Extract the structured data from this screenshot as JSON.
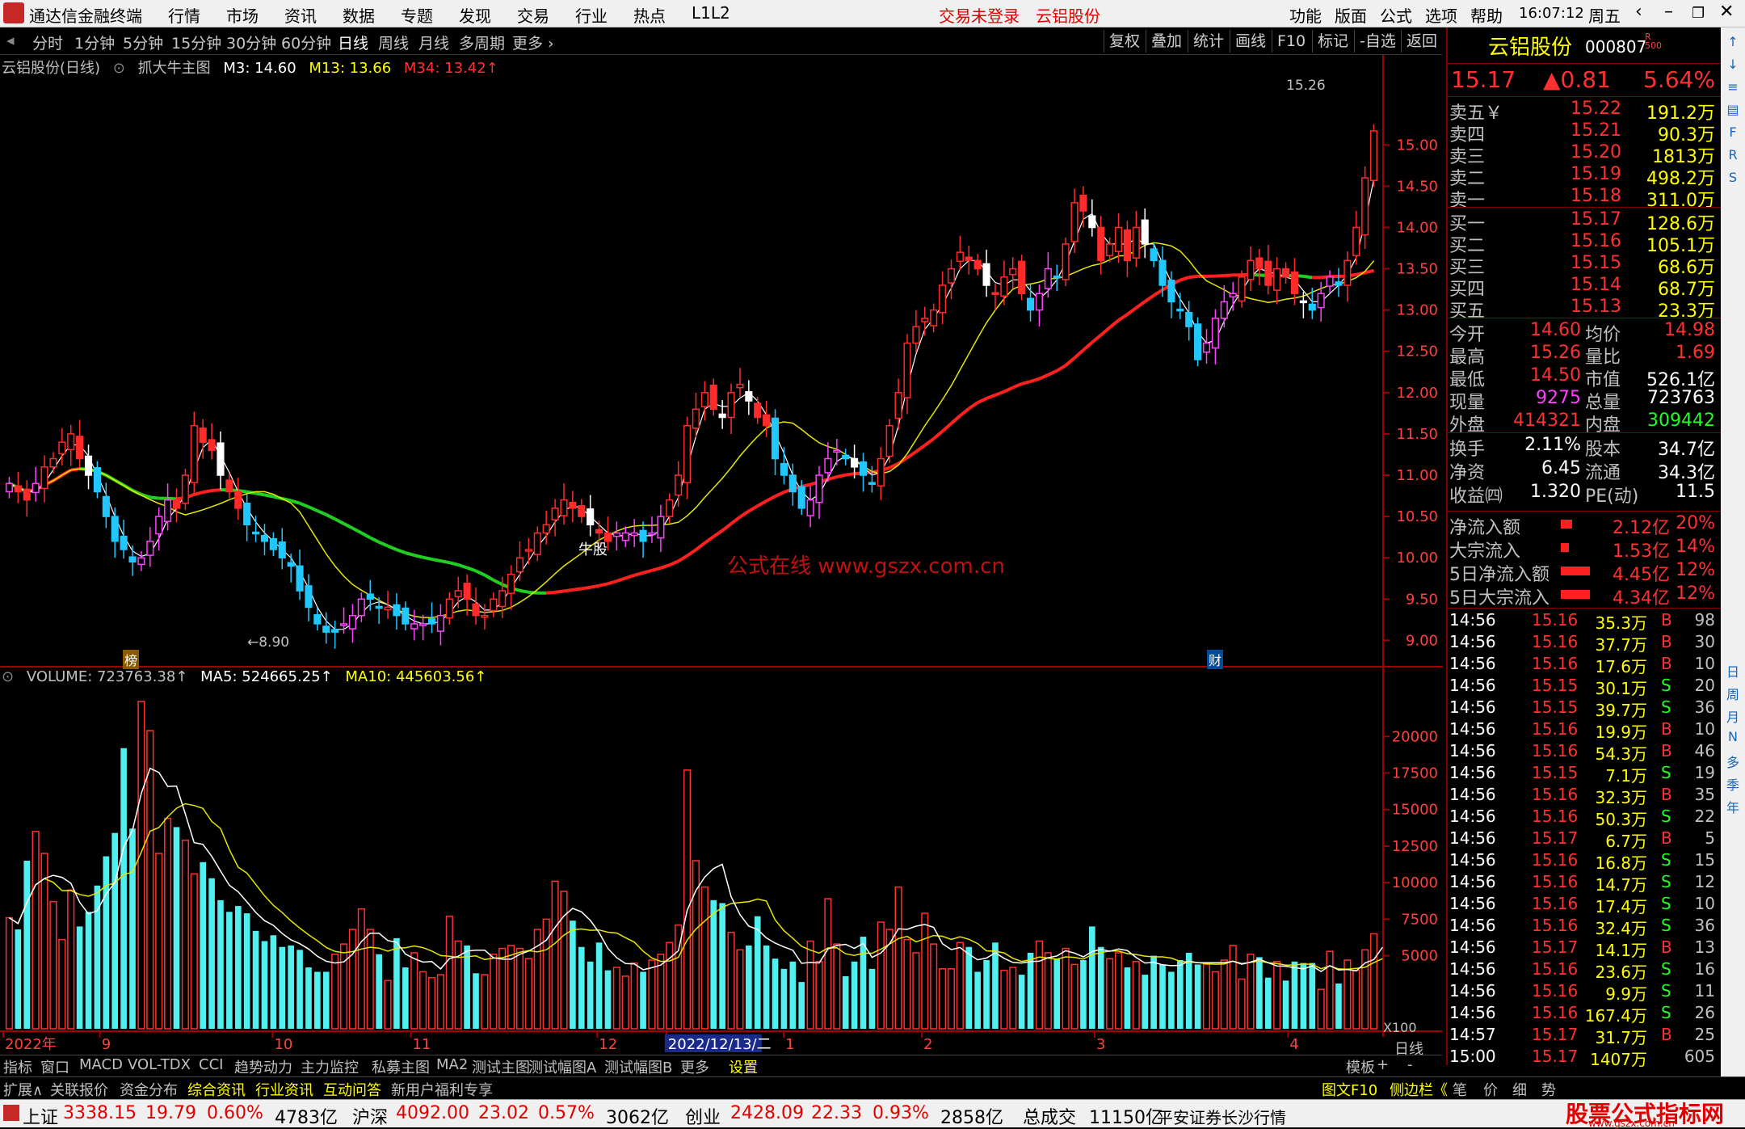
{
  "menubar": {
    "app_title": "通达信金融终端",
    "menus": [
      "行情",
      "市场",
      "资讯",
      "数据",
      "专题",
      "发现",
      "交易",
      "行业",
      "热点",
      "L1L2"
    ],
    "login_status": "交易未登录",
    "stock_name": "云铝股份",
    "right_menus": [
      "功能",
      "版面",
      "公式",
      "选项",
      "帮助"
    ],
    "time": "16:07:12",
    "weekday": "周五"
  },
  "periodbar": {
    "periods": [
      "分时",
      "1分钟",
      "5分钟",
      "15分钟",
      "30分钟",
      "60分钟",
      "日线",
      "周线",
      "月线",
      "多周期",
      "更多 ›"
    ],
    "active": "日线",
    "tools": [
      "复权",
      "叠加",
      "统计",
      "画线",
      "F10",
      "标记",
      "-自选",
      "返回"
    ]
  },
  "chart_legend": {
    "title": "云铝股份(日线)",
    "indicator": "抓大牛主图",
    "m3": "M3: 14.60",
    "m13": "M13: 13.66",
    "m34": "M34: 13.42↑",
    "high_label": "15.26",
    "low_label": "←8.90",
    "bull_label": "牛股",
    "watermark": "公式在线  www.gszx.com.cn",
    "marker_bang": "榜",
    "marker_cai": "财"
  },
  "volume_legend": {
    "volume": "VOLUME: 723763.38↑",
    "ma5": "MA5: 524665.25↑",
    "ma10": "MA10: 445603.56↑",
    "unit": "X100",
    "period_label": "日线"
  },
  "price_axis": [
    "15.00",
    "14.50",
    "14.00",
    "13.50",
    "13.00",
    "12.50",
    "12.00",
    "11.50",
    "11.00",
    "10.50",
    "10.00",
    "9.50",
    "9.00"
  ],
  "volume_axis": [
    "20000",
    "17500",
    "15000",
    "12500",
    "10000",
    "7500",
    "5000"
  ],
  "date_axis": [
    "2022年",
    "9",
    "10",
    "11",
    "12",
    "2022/12/13/二",
    "1",
    "2",
    "3",
    "4"
  ],
  "quote": {
    "name": "云铝股份",
    "code": "000807",
    "flags": "R 500",
    "price": "15.17",
    "change": "▲0.81",
    "pct": "5.64%",
    "asks": [
      {
        "label": "卖五￥",
        "price": "15.22",
        "vol": "191.2万"
      },
      {
        "label": "卖四",
        "price": "15.21",
        "vol": "90.3万"
      },
      {
        "label": "卖三",
        "price": "15.20",
        "vol": "1813万"
      },
      {
        "label": "卖二",
        "price": "15.19",
        "vol": "498.2万"
      },
      {
        "label": "卖一",
        "price": "15.18",
        "vol": "311.0万"
      }
    ],
    "bids": [
      {
        "label": "买一",
        "price": "15.17",
        "vol": "128.6万"
      },
      {
        "label": "买二",
        "price": "15.16",
        "vol": "105.1万"
      },
      {
        "label": "买三",
        "price": "15.15",
        "vol": "68.6万"
      },
      {
        "label": "买四",
        "price": "15.14",
        "vol": "68.7万"
      },
      {
        "label": "买五",
        "price": "15.13",
        "vol": "23.3万"
      }
    ],
    "stats1": [
      {
        "l1": "今开",
        "v1": "14.60",
        "l2": "均价",
        "v2": "14.98"
      },
      {
        "l1": "最高",
        "v1": "15.26",
        "l2": "量比",
        "v2": "1.69"
      },
      {
        "l1": "最低",
        "v1": "14.50",
        "l2": "市值",
        "v2": "526.1亿"
      },
      {
        "l1": "现量",
        "v1": "9275",
        "l2": "总量",
        "v2": "723763"
      },
      {
        "l1": "外盘",
        "v1": "414321",
        "l2": "内盘",
        "v2": "309442"
      }
    ],
    "stats2": [
      {
        "l1": "换手",
        "v1": "2.11%",
        "l2": "股本",
        "v2": "34.7亿"
      },
      {
        "l1": "净资",
        "v1": "6.45",
        "l2": "流通",
        "v2": "34.3亿"
      },
      {
        "l1": "收益㈣",
        "v1": "1.320",
        "l2": "PE(动)",
        "v2": "11.5"
      }
    ],
    "flows": [
      {
        "label": "净流入额",
        "val": "2.12亿",
        "pct": "20%",
        "bar": 0.2
      },
      {
        "label": "大宗流入",
        "val": "1.53亿",
        "pct": "14%",
        "bar": 0.14
      },
      {
        "label": "5日净流入额",
        "val": "4.45亿",
        "pct": "12%",
        "bar": 0.5
      },
      {
        "label": "5日大宗流入",
        "val": "4.34亿",
        "pct": "12%",
        "bar": 0.5
      }
    ]
  },
  "ticks": [
    [
      "14:56",
      "15.16",
      "35.3万",
      "B",
      "98"
    ],
    [
      "14:56",
      "15.16",
      "37.7万",
      "B",
      "30"
    ],
    [
      "14:56",
      "15.16",
      "17.6万",
      "B",
      "10"
    ],
    [
      "14:56",
      "15.15",
      "30.1万",
      "S",
      "20"
    ],
    [
      "14:56",
      "15.15",
      "39.7万",
      "S",
      "36"
    ],
    [
      "14:56",
      "15.16",
      "19.9万",
      "B",
      "10"
    ],
    [
      "14:56",
      "15.16",
      "54.3万",
      "B",
      "46"
    ],
    [
      "14:56",
      "15.15",
      "7.1万",
      "S",
      "19"
    ],
    [
      "14:56",
      "15.16",
      "32.3万",
      "B",
      "35"
    ],
    [
      "14:56",
      "15.16",
      "50.3万",
      "S",
      "22"
    ],
    [
      "14:56",
      "15.17",
      "6.7万",
      "B",
      "5"
    ],
    [
      "14:56",
      "15.16",
      "16.8万",
      "S",
      "15"
    ],
    [
      "14:56",
      "15.16",
      "14.7万",
      "S",
      "12"
    ],
    [
      "14:56",
      "15.16",
      "17.4万",
      "S",
      "10"
    ],
    [
      "14:56",
      "15.16",
      "32.4万",
      "S",
      "36"
    ],
    [
      "14:56",
      "15.17",
      "14.1万",
      "B",
      "13"
    ],
    [
      "14:56",
      "15.16",
      "23.6万",
      "S",
      "16"
    ],
    [
      "14:56",
      "15.16",
      "9.9万",
      "S",
      "11"
    ],
    [
      "14:56",
      "15.16",
      "167.4万",
      "S",
      "26"
    ],
    [
      "14:57",
      "15.17",
      "31.7万",
      "B",
      "25"
    ],
    [
      "15:00",
      "15.17",
      "1407万",
      "",
      "605"
    ]
  ],
  "bottom_tabs": [
    "指标",
    "窗口",
    "MACD",
    "VOL-TDX",
    "CCI",
    "趋势动力",
    "主力监控",
    "私募主图",
    "MA2",
    "测试主图",
    "测试幅图A",
    "测试幅图B",
    "更多",
    "设置"
  ],
  "bottom_right": [
    "模板",
    "+",
    "-"
  ],
  "bottom_tabs2": [
    "扩展∧",
    "关联报价",
    "资金分布",
    "综合资讯",
    "行业资讯",
    "互动问答",
    "新用户福利专享"
  ],
  "bottom_tabs2_right": [
    "图文F10",
    "侧边栏《",
    "笔",
    "价",
    "细",
    "势"
  ],
  "status": {
    "sh_label": "上证",
    "sh_val": "3338.15",
    "sh_chg": "19.79",
    "sh_pct": "0.60%",
    "sh_amt": "4783亿",
    "sz_label": "沪深",
    "sz_val": "4092.00",
    "sz_chg": "23.02",
    "sz_pct": "0.57%",
    "sz_amt": "3062亿",
    "cy_label": "创业",
    "cy_val": "2428.09",
    "cy_chg": "22.33",
    "cy_pct": "0.93%",
    "cy_amt": "2858亿",
    "total_label": "总成交",
    "total_val": "11150亿",
    "server": "平安证券长沙行情",
    "brand": "股票公式指标网",
    "brand_url": "www.gszx.com.cn"
  },
  "right_toolbar_icons": [
    "up-arrow-icon",
    "down-arrow-icon",
    "list-icon",
    "chart-icon",
    "f10-icon",
    "rsi-icon",
    "fs-icon",
    "day-icon",
    "week-icon",
    "month-icon",
    "n-icon",
    "multi-icon",
    "season-icon",
    "year-icon"
  ],
  "chart_data": {
    "type": "candlestick",
    "description_series": "daily OHLC approx with MA3/MA13/MA34",
    "ylim": [
      8.7,
      15.6
    ],
    "candles_close": [
      10.9,
      10.8,
      10.7,
      10.9,
      11.1,
      11.2,
      11.4,
      11.5,
      11.2,
      11.0,
      10.8,
      10.5,
      10.2,
      10.1,
      9.95,
      10.0,
      10.2,
      10.5,
      10.7,
      10.6,
      11.0,
      11.6,
      11.4,
      11.3,
      11.0,
      10.8,
      10.6,
      10.4,
      10.3,
      10.2,
      10.1,
      10.0,
      9.9,
      9.6,
      9.4,
      9.2,
      9.1,
      9.1,
      9.2,
      9.3,
      9.5,
      9.5,
      9.4,
      9.4,
      9.3,
      9.2,
      9.2,
      9.2,
      9.2,
      9.3,
      9.5,
      9.6,
      9.5,
      9.3,
      9.3,
      9.5,
      9.6,
      9.8,
      10.0,
      10.1,
      10.3,
      10.4,
      10.6,
      10.7,
      10.6,
      10.5,
      10.4,
      10.3,
      10.2,
      10.3,
      10.3,
      10.3,
      10.2,
      10.3,
      10.5,
      10.7,
      11.0,
      11.6,
      11.8,
      12.0,
      11.8,
      11.7,
      12.0,
      12.1,
      11.9,
      11.7,
      11.6,
      11.2,
      11.0,
      10.8,
      10.6,
      10.7,
      11.0,
      11.2,
      11.3,
      11.2,
      11.1,
      11.0,
      10.9,
      11.2,
      11.6,
      12.0,
      12.6,
      12.8,
      12.9,
      13.0,
      13.3,
      13.5,
      13.7,
      13.6,
      13.5,
      13.3,
      13.2,
      13.4,
      13.5,
      13.2,
      13.0,
      13.2,
      13.5,
      13.4,
      13.8,
      14.3,
      14.2,
      14.0,
      13.6,
      13.8,
      14.0,
      13.6,
      14.0,
      13.8,
      13.6,
      13.3,
      13.1,
      13.0,
      12.8,
      12.4,
      12.6,
      12.9,
      13.1,
      13.2,
      13.4,
      13.6,
      13.5,
      13.3,
      13.5,
      13.4,
      13.2,
      13.1,
      13.0,
      13.2,
      13.4,
      13.3,
      13.6,
      14.0,
      14.6,
      15.17
    ],
    "volume_values": [
      7600,
      6800,
      11500,
      13500,
      12000,
      8700,
      6100,
      9500,
      7000,
      8000,
      9800,
      11800,
      13400,
      19200,
      13700,
      22400,
      20400,
      12000,
      14400,
      13800,
      12900,
      10600,
      11400,
      10300,
      8800,
      8000,
      8400,
      7900,
      6700,
      6000,
      6400,
      5600,
      5700,
      5400,
      4200,
      3900,
      3900,
      5100,
      5800,
      6800,
      8200,
      6800,
      5100,
      3300,
      6200,
      4200,
      5200,
      3900,
      3500,
      3700,
      7700,
      6000,
      5700,
      3800,
      3700,
      5100,
      5500,
      5700,
      5500,
      4800,
      6800,
      7500,
      10100,
      9400,
      7400,
      5600,
      4600,
      5900,
      4000,
      4200,
      3600,
      4500,
      3900,
      4700,
      5100,
      5900,
      7100,
      17700,
      11500,
      9700,
      8800,
      8600,
      6600,
      5400,
      5700,
      7700,
      5700,
      4800,
      4100,
      4600,
      3200,
      6000,
      4600,
      8900,
      5800,
      3600,
      4600,
      6300,
      4100,
      7300,
      6800,
      9700,
      6100,
      5200,
      7900,
      5800,
      4100,
      4100,
      5900,
      5600,
      3900,
      4700,
      5900,
      4000,
      4200,
      3700,
      5200,
      6000,
      5200,
      4800,
      5500,
      4400,
      4700,
      7000,
      5600,
      4800,
      5200,
      4200,
      4600,
      3700,
      5000,
      4400,
      3900,
      4700,
      5200,
      4400,
      4400,
      3900,
      4700,
      5700,
      3400,
      5100,
      4900,
      3500,
      4600,
      3300,
      4600,
      4500,
      4500,
      2700,
      5300,
      3100,
      4700,
      4000,
      5400,
      6500,
      7300
    ]
  }
}
